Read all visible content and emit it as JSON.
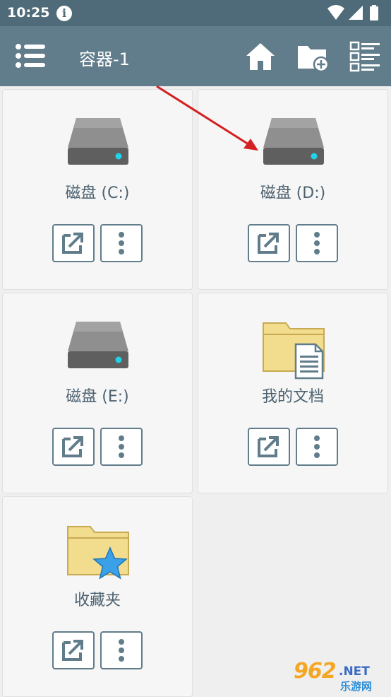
{
  "status_bar": {
    "time": "10:25",
    "info_glyph": "i"
  },
  "toolbar": {
    "title": "容器-1",
    "menu_icon": "list-menu-icon",
    "home_icon": "home-icon",
    "new_folder_icon": "folder-add-icon",
    "view_icon": "list-view-icon"
  },
  "items": [
    {
      "label": "磁盘 (C:)",
      "icon": "hard-drive-icon"
    },
    {
      "label": "磁盘 (D:)",
      "icon": "hard-drive-icon"
    },
    {
      "label": "磁盘 (E:)",
      "icon": "hard-drive-icon"
    },
    {
      "label": "我的文档",
      "icon": "documents-folder-icon"
    },
    {
      "label": "收藏夹",
      "icon": "favorites-folder-icon"
    }
  ],
  "item_buttons": {
    "open_icon": "open-external-icon",
    "more_icon": "more-vertical-icon"
  },
  "watermark": {
    "brand": "962",
    "suffix": ".NET",
    "sub": "乐游网"
  },
  "colors": {
    "status_bar": "#4f6a78",
    "toolbar": "#617d8b",
    "accent_led": "#22d3e6",
    "annotation_arrow": "#d32020"
  }
}
